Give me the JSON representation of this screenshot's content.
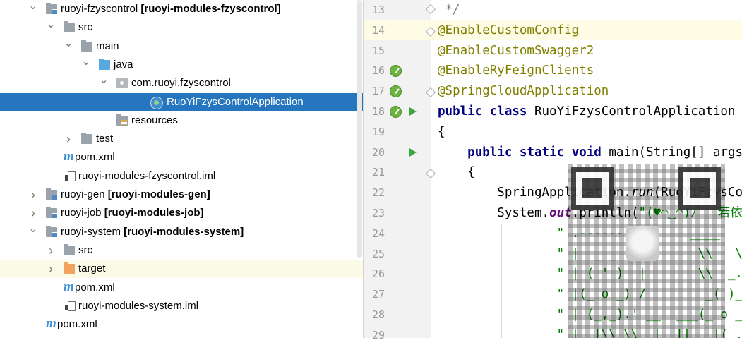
{
  "project_tree": [
    {
      "indent": 0,
      "expanded": true,
      "icon": "module-folder-icon",
      "label": "ruoyi-fzyscontrol",
      "bold": "[ruoyi-modules-fzyscontrol]"
    },
    {
      "indent": 1,
      "expanded": true,
      "icon": "folder-icon",
      "label": "src"
    },
    {
      "indent": 2,
      "expanded": true,
      "icon": "folder-icon",
      "label": "main"
    },
    {
      "indent": 3,
      "expanded": true,
      "icon": "source-folder-icon",
      "label": "java"
    },
    {
      "indent": 4,
      "expanded": true,
      "icon": "package-icon",
      "label": "com.ruoyi.fzyscontrol"
    },
    {
      "indent": 5,
      "icon": "spring-boot-class-icon",
      "label": "RuoYiFzysControlApplication",
      "selected": true
    },
    {
      "indent": 4,
      "icon": "resources-folder-icon",
      "label": "resources"
    },
    {
      "indent": 2,
      "expanded": false,
      "icon": "folder-icon",
      "label": "test"
    },
    {
      "indent": 1,
      "icon": "maven-icon",
      "label": "pom.xml"
    },
    {
      "indent": 1,
      "icon": "iml-file-icon",
      "label": "ruoyi-modules-fzyscontrol.iml"
    },
    {
      "indent": 0,
      "expanded": false,
      "icon": "module-folder-icon",
      "label": "ruoyi-gen",
      "bold": "[ruoyi-modules-gen]"
    },
    {
      "indent": 0,
      "expanded": false,
      "icon": "module-folder-icon",
      "label": "ruoyi-job",
      "bold": "[ruoyi-modules-job]"
    },
    {
      "indent": 0,
      "expanded": true,
      "icon": "module-folder-icon",
      "label": "ruoyi-system",
      "bold": "[ruoyi-modules-system]"
    },
    {
      "indent": 1,
      "expanded": false,
      "icon": "folder-icon",
      "label": "src"
    },
    {
      "indent": 1,
      "expanded": false,
      "icon": "excluded-folder-icon",
      "label": "target",
      "highlighted": true
    },
    {
      "indent": 1,
      "icon": "maven-icon",
      "label": "pom.xml"
    },
    {
      "indent": 1,
      "icon": "iml-file-icon",
      "label": "ruoyi-modules-system.iml"
    },
    {
      "indent": 0,
      "icon": "maven-icon",
      "label": "pom.xml"
    }
  ],
  "editor": {
    "lines": [
      {
        "n": "13",
        "tokens": [
          {
            "t": " */",
            "c": "cmt"
          }
        ]
      },
      {
        "n": "14",
        "current": true,
        "tokens": [
          {
            "t": "@EnableCustomConfig",
            "c": "ann"
          }
        ]
      },
      {
        "n": "15",
        "tokens": [
          {
            "t": "@EnableCustomSwagger2",
            "c": "ann"
          }
        ]
      },
      {
        "n": "16",
        "gutter": [
          "bean"
        ],
        "tokens": [
          {
            "t": "@EnableRyFeignClients",
            "c": "ann"
          }
        ]
      },
      {
        "n": "17",
        "gutter": [
          "bean"
        ],
        "tokens": [
          {
            "t": "@SpringCloudApplication",
            "c": "ann"
          }
        ]
      },
      {
        "n": "18",
        "gutter": [
          "bean",
          "run"
        ],
        "tokens": [
          {
            "t": "public",
            "c": "kw"
          },
          {
            "t": " "
          },
          {
            "t": "class",
            "c": "kw"
          },
          {
            "t": " RuoYiFzysControlApplication"
          }
        ]
      },
      {
        "n": "19",
        "tokens": [
          {
            "t": "{"
          }
        ]
      },
      {
        "n": "20",
        "gutter": [
          "run"
        ],
        "tokens": [
          {
            "t": "    "
          },
          {
            "t": "public",
            "c": "kw"
          },
          {
            "t": " "
          },
          {
            "t": "static",
            "c": "kw"
          },
          {
            "t": " "
          },
          {
            "t": "void",
            "c": "kw"
          },
          {
            "t": " main(String[] args)"
          }
        ]
      },
      {
        "n": "21",
        "tokens": [
          {
            "t": "    {"
          }
        ]
      },
      {
        "n": "22",
        "tokens": [
          {
            "t": "        SpringApplication."
          },
          {
            "t": "run",
            "c": "it"
          },
          {
            "t": "(RuoYiFzysControlApplication.class, args);"
          }
        ]
      },
      {
        "n": "23",
        "tokens": [
          {
            "t": "        System."
          },
          {
            "t": "out",
            "c": "fld"
          },
          {
            "t": ".println("
          },
          {
            "t": "\"(♥◠‿◠)ﾉﾞ  若依启动成功   ლ(´ڡ`ლ)ﾞ  \\n\" +",
            "c": "str"
          }
        ]
      },
      {
        "n": "24",
        "tokens": [
          {
            "t": "                \" .-------.       ____     __        \\n\" +",
            "c": "str"
          }
        ]
      },
      {
        "n": "25",
        "tokens": [
          {
            "t": "                \" |  _ _   \\\\      \\\\   \\\\   /  /    \\n\" +",
            "c": "str"
          }
        ]
      },
      {
        "n": "26",
        "tokens": [
          {
            "t": "                \" | ( ' )  |       \\\\  _. /  '       \\n\" +",
            "c": "str"
          }
        ]
      },
      {
        "n": "27",
        "tokens": [
          {
            "t": "                \" |(_ o _) /        _( )_ .'         \\n\" +",
            "c": "str"
          }
        ]
      },
      {
        "n": "28",
        "tokens": [
          {
            "t": "                \" | (_,_).' __  ___(_ o _)'          \\n\" +",
            "c": "str"
          }
        ]
      },
      {
        "n": "29",
        "tokens": [
          {
            "t": "                \" |  |\\\\ \\\\  |  ||   |(_,_)'         \\n\" +",
            "c": "str"
          }
        ]
      }
    ]
  },
  "colors": {
    "selection": "#2675bf",
    "annotation": "#808000",
    "keyword": "#000080",
    "string": "#008000",
    "current_line": "#fefce5"
  }
}
